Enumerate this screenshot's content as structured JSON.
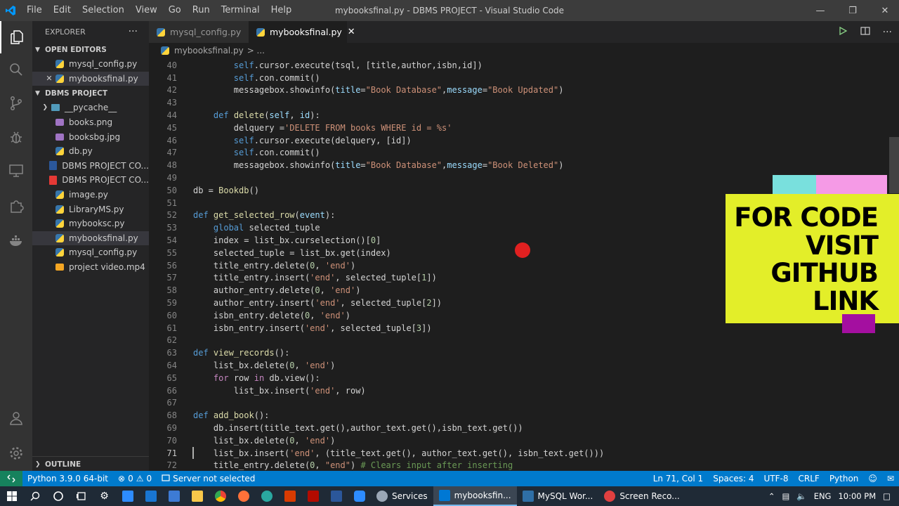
{
  "titlebar": {
    "menu": [
      "File",
      "Edit",
      "Selection",
      "View",
      "Go",
      "Run",
      "Terminal",
      "Help"
    ],
    "title": "mybooksfinal.py - DBMS PROJECT - Visual Studio Code"
  },
  "sidebar": {
    "header": "EXPLORER",
    "more": "···",
    "open_editors_title": "OPEN EDITORS",
    "open_editors": [
      {
        "name": "mysql_config.py",
        "icon": "python-file-icon"
      },
      {
        "name": "mybooksfinal.py",
        "icon": "python-file-icon"
      }
    ],
    "project_title": "DBMS PROJECT",
    "files": [
      {
        "name": "__pycache__",
        "icon": "folder-icon"
      },
      {
        "name": "books.png",
        "icon": "image-file-icon"
      },
      {
        "name": "booksbg.jpg",
        "icon": "image-file-icon"
      },
      {
        "name": "db.py",
        "icon": "python-file-icon"
      },
      {
        "name": "DBMS PROJECT CO...",
        "icon": "word-file-icon"
      },
      {
        "name": "DBMS PROJECT CO...",
        "icon": "pdf-file-icon"
      },
      {
        "name": "image.py",
        "icon": "python-file-icon"
      },
      {
        "name": "LibraryMS.py",
        "icon": "python-file-icon"
      },
      {
        "name": "mybooksc.py",
        "icon": "python-file-icon"
      },
      {
        "name": "mybooksfinal.py",
        "icon": "python-file-icon"
      },
      {
        "name": "mysql_config.py",
        "icon": "python-file-icon"
      },
      {
        "name": "project video.mp4",
        "icon": "video-file-icon"
      }
    ],
    "outline_title": "OUTLINE"
  },
  "tabs": [
    {
      "label": "mysql_config.py",
      "active": false
    },
    {
      "label": "mybooksfinal.py",
      "active": true
    }
  ],
  "breadcrumb": {
    "file": "mybooksfinal.py",
    "sep": "> ..."
  },
  "editor": {
    "current_line": 71,
    "lines": [
      {
        "n": "40",
        "t": [
          [
            "        ",
            ""
          ],
          [
            "self",
            "kw"
          ],
          [
            ".cursor.execute(tsql, [title,author,isbn,id])",
            ""
          ]
        ]
      },
      {
        "n": "41",
        "t": [
          [
            "        ",
            ""
          ],
          [
            "self",
            "kw"
          ],
          [
            ".con.commit()",
            ""
          ]
        ]
      },
      {
        "n": "42",
        "t": [
          [
            "        messagebox.showinfo(",
            ""
          ],
          [
            "title",
            "pm"
          ],
          [
            "=",
            ""
          ],
          [
            "\"Book Database\"",
            "st"
          ],
          [
            ",",
            ""
          ],
          [
            "message",
            "pm"
          ],
          [
            "=",
            ""
          ],
          [
            "\"Book Updated\"",
            "st"
          ],
          [
            ")",
            ""
          ]
        ]
      },
      {
        "n": "43",
        "t": []
      },
      {
        "n": "44",
        "t": [
          [
            "    ",
            ""
          ],
          [
            "def",
            "kw"
          ],
          [
            " ",
            ""
          ],
          [
            "delete",
            "fn"
          ],
          [
            "(",
            ""
          ],
          [
            "self",
            "pm"
          ],
          [
            ", ",
            ""
          ],
          [
            "id",
            "pm"
          ],
          [
            "):",
            ""
          ]
        ]
      },
      {
        "n": "45",
        "t": [
          [
            "        delquery =",
            ""
          ],
          [
            "'DELETE FROM books WHERE id = %s'",
            "st"
          ]
        ]
      },
      {
        "n": "46",
        "t": [
          [
            "        ",
            ""
          ],
          [
            "self",
            "kw"
          ],
          [
            ".cursor.execute(delquery, [id])",
            ""
          ]
        ]
      },
      {
        "n": "47",
        "t": [
          [
            "        ",
            ""
          ],
          [
            "self",
            "kw"
          ],
          [
            ".con.commit()",
            ""
          ]
        ]
      },
      {
        "n": "48",
        "t": [
          [
            "        messagebox.showinfo(",
            ""
          ],
          [
            "title",
            "pm"
          ],
          [
            "=",
            ""
          ],
          [
            "\"Book Database\"",
            "st"
          ],
          [
            ",",
            ""
          ],
          [
            "message",
            "pm"
          ],
          [
            "=",
            ""
          ],
          [
            "\"Book Deleted\"",
            "st"
          ],
          [
            ")",
            ""
          ]
        ]
      },
      {
        "n": "49",
        "t": []
      },
      {
        "n": "50",
        "t": [
          [
            "db = ",
            ""
          ],
          [
            "Bookdb",
            "fn"
          ],
          [
            "()",
            ""
          ]
        ]
      },
      {
        "n": "51",
        "t": []
      },
      {
        "n": "52",
        "t": [
          [
            "def",
            "kw"
          ],
          [
            " ",
            ""
          ],
          [
            "get_selected_row",
            "fn"
          ],
          [
            "(",
            ""
          ],
          [
            "event",
            "pm"
          ],
          [
            "):",
            ""
          ]
        ]
      },
      {
        "n": "53",
        "t": [
          [
            "    ",
            ""
          ],
          [
            "global",
            "kw"
          ],
          [
            " selected_tuple",
            ""
          ]
        ]
      },
      {
        "n": "54",
        "t": [
          [
            "    index = list_bx.curselection()[",
            ""
          ],
          [
            "0",
            "nm"
          ],
          [
            "]",
            ""
          ]
        ]
      },
      {
        "n": "55",
        "t": [
          [
            "    selected_tuple = list_bx.get(index)",
            ""
          ]
        ]
      },
      {
        "n": "56",
        "t": [
          [
            "    title_entry.delete(",
            ""
          ],
          [
            "0",
            "nm"
          ],
          [
            ", ",
            ""
          ],
          [
            "'end'",
            "st"
          ],
          [
            ")",
            ""
          ]
        ]
      },
      {
        "n": "57",
        "t": [
          [
            "    title_entry.insert(",
            ""
          ],
          [
            "'end'",
            "st"
          ],
          [
            ", selected_tuple[",
            ""
          ],
          [
            "1",
            "nm"
          ],
          [
            "])",
            ""
          ]
        ]
      },
      {
        "n": "58",
        "t": [
          [
            "    author_entry.delete(",
            ""
          ],
          [
            "0",
            "nm"
          ],
          [
            ", ",
            ""
          ],
          [
            "'end'",
            "st"
          ],
          [
            ")",
            ""
          ]
        ]
      },
      {
        "n": "59",
        "t": [
          [
            "    author_entry.insert(",
            ""
          ],
          [
            "'end'",
            "st"
          ],
          [
            ", selected_tuple[",
            ""
          ],
          [
            "2",
            "nm"
          ],
          [
            "])",
            ""
          ]
        ]
      },
      {
        "n": "60",
        "t": [
          [
            "    isbn_entry.delete(",
            ""
          ],
          [
            "0",
            "nm"
          ],
          [
            ", ",
            ""
          ],
          [
            "'end'",
            "st"
          ],
          [
            ")",
            ""
          ]
        ]
      },
      {
        "n": "61",
        "t": [
          [
            "    isbn_entry.insert(",
            ""
          ],
          [
            "'end'",
            "st"
          ],
          [
            ", selected_tuple[",
            ""
          ],
          [
            "3",
            "nm"
          ],
          [
            "])",
            ""
          ]
        ]
      },
      {
        "n": "62",
        "t": []
      },
      {
        "n": "63",
        "t": [
          [
            "def",
            "kw"
          ],
          [
            " ",
            ""
          ],
          [
            "view_records",
            "fn"
          ],
          [
            "():",
            ""
          ]
        ]
      },
      {
        "n": "64",
        "t": [
          [
            "    list_bx.delete(",
            ""
          ],
          [
            "0",
            "nm"
          ],
          [
            ", ",
            ""
          ],
          [
            "'end'",
            "st"
          ],
          [
            ")",
            ""
          ]
        ]
      },
      {
        "n": "65",
        "t": [
          [
            "    ",
            ""
          ],
          [
            "for",
            "kwc"
          ],
          [
            " row ",
            ""
          ],
          [
            "in",
            "kwc"
          ],
          [
            " db.view():",
            ""
          ]
        ]
      },
      {
        "n": "66",
        "t": [
          [
            "        list_bx.insert(",
            ""
          ],
          [
            "'end'",
            "st"
          ],
          [
            ", row)",
            ""
          ]
        ]
      },
      {
        "n": "67",
        "t": []
      },
      {
        "n": "68",
        "t": [
          [
            "def",
            "kw"
          ],
          [
            " ",
            ""
          ],
          [
            "add_book",
            "fn"
          ],
          [
            "():",
            ""
          ]
        ]
      },
      {
        "n": "69",
        "t": [
          [
            "    db.insert(title_text.get(),author_text.get(),isbn_text.get())",
            ""
          ]
        ]
      },
      {
        "n": "70",
        "t": [
          [
            "    list_bx.delete(",
            ""
          ],
          [
            "0",
            "nm"
          ],
          [
            ", ",
            ""
          ],
          [
            "'end'",
            "st"
          ],
          [
            ")",
            ""
          ]
        ]
      },
      {
        "n": "71",
        "t": [
          [
            "    list_bx.insert(",
            ""
          ],
          [
            "'end'",
            "st"
          ],
          [
            ", (title_text.get(), author_text.get(), isbn_text.get()))",
            ""
          ]
        ]
      },
      {
        "n": "72",
        "t": [
          [
            "    title_entry.delete(",
            ""
          ],
          [
            "0",
            "nm"
          ],
          [
            ", ",
            ""
          ],
          [
            "\"end\"",
            "st"
          ],
          [
            ") ",
            ""
          ],
          [
            "# Clears input after inserting",
            "cm"
          ]
        ]
      }
    ]
  },
  "overlay": {
    "text_lines": [
      "FOR CODE",
      "VISIT",
      "GITHUB",
      "LINK"
    ]
  },
  "status": {
    "python": "Python 3.9.0 64-bit",
    "errors": "0",
    "warnings": "0",
    "server": "Server not selected",
    "position": "Ln 71, Col 1",
    "spaces": "Spaces: 4",
    "encoding": "UTF-8",
    "eol": "CRLF",
    "language": "Python"
  },
  "taskbar": {
    "apps": [
      {
        "label": "Services",
        "icon_color": "#9aa7b6"
      },
      {
        "label": "mybooksfin...",
        "icon_color": "#0078d4",
        "active": true
      },
      {
        "label": "MySQL Wor...",
        "icon_color": "#2f6fa6"
      },
      {
        "label": "Screen Reco...",
        "icon_color": "#e04040"
      }
    ],
    "lang": "ENG",
    "time": "10:00 PM"
  },
  "colors": {
    "accent": "#007acc",
    "overlay_yellow": "#e3ee29",
    "overlay_cyan": "#79e0dd",
    "overlay_pink": "#f59ae6",
    "overlay_purple": "#a40fa0"
  }
}
